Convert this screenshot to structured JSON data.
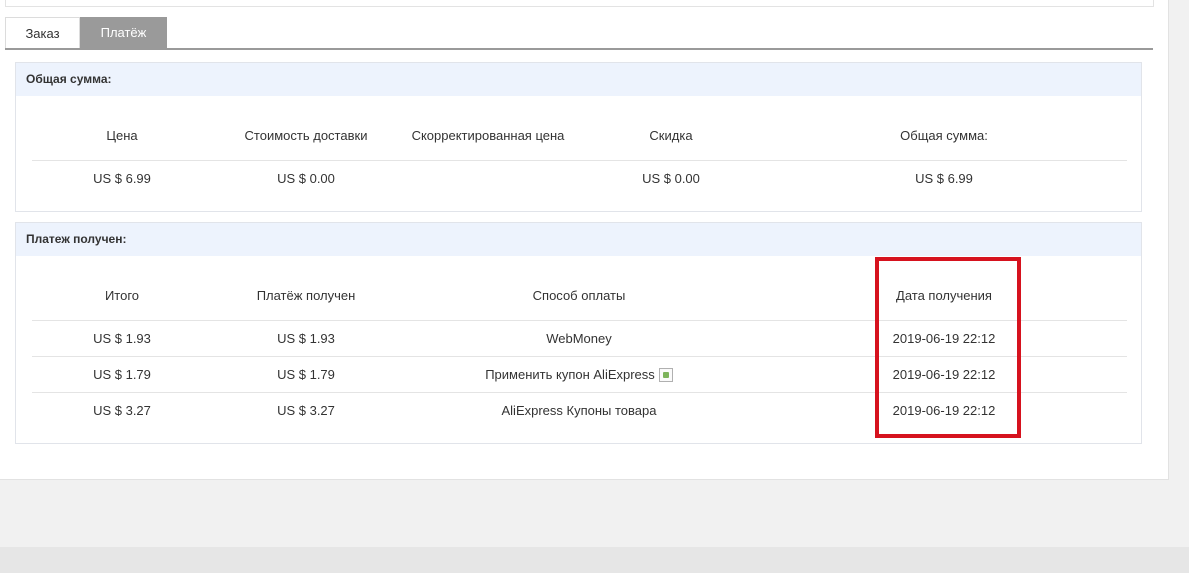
{
  "tabs": [
    {
      "label": "Заказ",
      "active": false
    },
    {
      "label": "Платёж",
      "active": true
    }
  ],
  "total_panel": {
    "title": "Общая сумма:",
    "headers": [
      "Цена",
      "Стоимость доставки",
      "Скорректированная цена",
      "Скидка",
      "Общая сумма:"
    ],
    "row": [
      "US $ 6.99",
      "US $ 0.00",
      "",
      "US $ 0.00",
      "US $ 6.99"
    ]
  },
  "payment_panel": {
    "title": "Платеж получен:",
    "headers": [
      "Итого",
      "Платёж получен",
      "Способ оплаты",
      "Дата получения"
    ],
    "rows": [
      {
        "total": "US $ 1.93",
        "received": "US $ 1.93",
        "method": "WebMoney",
        "date": "2019-06-19 22:12",
        "icon": false
      },
      {
        "total": "US $ 1.79",
        "received": "US $ 1.79",
        "method": "Применить купон AliExpress",
        "date": "2019-06-19 22:12",
        "icon": "broken-image-icon"
      },
      {
        "total": "US $ 3.27",
        "received": "US $ 3.27",
        "method": "AliExpress Купоны товара",
        "date": "2019-06-19 22:12",
        "icon": false
      }
    ]
  },
  "colors": {
    "tab_active_bg": "#9a9a9a",
    "panel_header_bg": "#edf3fd",
    "highlight_border": "#d6121e"
  }
}
